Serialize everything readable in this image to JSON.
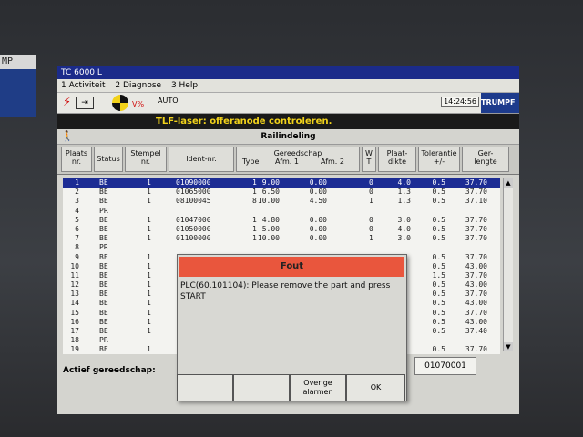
{
  "sticker": {
    "text": "MP"
  },
  "window": {
    "title": "TC 6000 L"
  },
  "menu": {
    "items": [
      "1 Activiteit",
      "2 Diagnose",
      "3 Help"
    ]
  },
  "status": {
    "vpct": "V%",
    "mode": "AUTO",
    "time": "14:24:56",
    "brand": "TRUMPF"
  },
  "message": "TLF-laser: offeranode controleren.",
  "section_title": "Railindeling",
  "columns": {
    "plaats": "Plaats\nnr.",
    "status": "Status",
    "stempel": "Stempel\nnr.",
    "ident": "Ident-nr.",
    "gereedschap": "Gereedschap",
    "type": "Type",
    "afm1": "Afm. 1",
    "afm2": "Afm. 2",
    "w": "W\nT",
    "plaatdikte": "Plaat-\ndikte",
    "tolerantie": "Tolerantie\n+/-",
    "gerlengte": "Ger-\nlengte"
  },
  "rows": [
    {
      "nr": "1",
      "status": "BE",
      "stempel": "1",
      "ident": "01090000",
      "type": "1",
      "afm1": "9.00",
      "afm2": "0.00",
      "w": "0",
      "dikte": "4.0",
      "tol": "0.5",
      "len": "37.70",
      "sel": true
    },
    {
      "nr": "2",
      "status": "BE",
      "stempel": "1",
      "ident": "01065000",
      "type": "1",
      "afm1": "6.50",
      "afm2": "0.00",
      "w": "0",
      "dikte": "1.3",
      "tol": "0.5",
      "len": "37.70"
    },
    {
      "nr": "3",
      "status": "BE",
      "stempel": "1",
      "ident": "08100045",
      "type": "8",
      "afm1": "10.00",
      "afm2": "4.50",
      "w": "1",
      "dikte": "1.3",
      "tol": "0.5",
      "len": "37.10"
    },
    {
      "nr": "4",
      "status": "PR",
      "stempel": "",
      "ident": "",
      "type": "",
      "afm1": "",
      "afm2": "",
      "w": "",
      "dikte": "",
      "tol": "",
      "len": ""
    },
    {
      "nr": "5",
      "status": "BE",
      "stempel": "1",
      "ident": "01047000",
      "type": "1",
      "afm1": "4.80",
      "afm2": "0.00",
      "w": "0",
      "dikte": "3.0",
      "tol": "0.5",
      "len": "37.70"
    },
    {
      "nr": "6",
      "status": "BE",
      "stempel": "1",
      "ident": "01050000",
      "type": "1",
      "afm1": "5.00",
      "afm2": "0.00",
      "w": "0",
      "dikte": "4.0",
      "tol": "0.5",
      "len": "37.70"
    },
    {
      "nr": "7",
      "status": "BE",
      "stempel": "1",
      "ident": "01100000",
      "type": "1",
      "afm1": "10.00",
      "afm2": "0.00",
      "w": "1",
      "dikte": "3.0",
      "tol": "0.5",
      "len": "37.70"
    },
    {
      "nr": "8",
      "status": "PR",
      "stempel": "",
      "ident": "",
      "type": "",
      "afm1": "",
      "afm2": "",
      "w": "",
      "dikte": "",
      "tol": "",
      "len": ""
    },
    {
      "nr": "9",
      "status": "BE",
      "stempel": "1",
      "ident": "",
      "type": "",
      "afm1": "",
      "afm2": "",
      "w": "",
      "dikte": "",
      "tol": "0.5",
      "len": "37.70"
    },
    {
      "nr": "10",
      "status": "BE",
      "stempel": "1",
      "ident": "",
      "type": "",
      "afm1": "",
      "afm2": "",
      "w": "",
      "dikte": "",
      "tol": "0.5",
      "len": "43.00"
    },
    {
      "nr": "11",
      "status": "BE",
      "stempel": "1",
      "ident": "",
      "type": "",
      "afm1": "",
      "afm2": "",
      "w": "",
      "dikte": "",
      "tol": "1.5",
      "len": "37.70"
    },
    {
      "nr": "12",
      "status": "BE",
      "stempel": "1",
      "ident": "",
      "type": "",
      "afm1": "",
      "afm2": "",
      "w": "",
      "dikte": "",
      "tol": "0.5",
      "len": "43.00"
    },
    {
      "nr": "13",
      "status": "BE",
      "stempel": "1",
      "ident": "",
      "type": "",
      "afm1": "",
      "afm2": "",
      "w": "",
      "dikte": "",
      "tol": "0.5",
      "len": "37.70"
    },
    {
      "nr": "14",
      "status": "BE",
      "stempel": "1",
      "ident": "",
      "type": "",
      "afm1": "",
      "afm2": "",
      "w": "",
      "dikte": "",
      "tol": "0.5",
      "len": "43.00"
    },
    {
      "nr": "15",
      "status": "BE",
      "stempel": "1",
      "ident": "",
      "type": "",
      "afm1": "",
      "afm2": "",
      "w": "",
      "dikte": "",
      "tol": "0.5",
      "len": "37.70"
    },
    {
      "nr": "16",
      "status": "BE",
      "stempel": "1",
      "ident": "",
      "type": "",
      "afm1": "",
      "afm2": "",
      "w": "",
      "dikte": "",
      "tol": "0.5",
      "len": "43.00"
    },
    {
      "nr": "17",
      "status": "BE",
      "stempel": "1",
      "ident": "",
      "type": "",
      "afm1": "",
      "afm2": "",
      "w": "",
      "dikte": "",
      "tol": "0.5",
      "len": "37.40"
    },
    {
      "nr": "18",
      "status": "PR",
      "stempel": "",
      "ident": "",
      "type": "",
      "afm1": "",
      "afm2": "",
      "w": "",
      "dikte": "",
      "tol": "",
      "len": ""
    },
    {
      "nr": "19",
      "status": "BE",
      "stempel": "1",
      "ident": "",
      "type": "",
      "afm1": "",
      "afm2": "",
      "w": "",
      "dikte": "",
      "tol": "0.5",
      "len": "37.70"
    }
  ],
  "dialog": {
    "title": "Fout",
    "message": "PLC(60.101104): Please remove the part and press START"
  },
  "footer": {
    "actief_label": "Actief gereedschap:",
    "ident_value": "01070001",
    "buttons": [
      "",
      "",
      "Overige\nalarmen",
      "OK"
    ]
  }
}
